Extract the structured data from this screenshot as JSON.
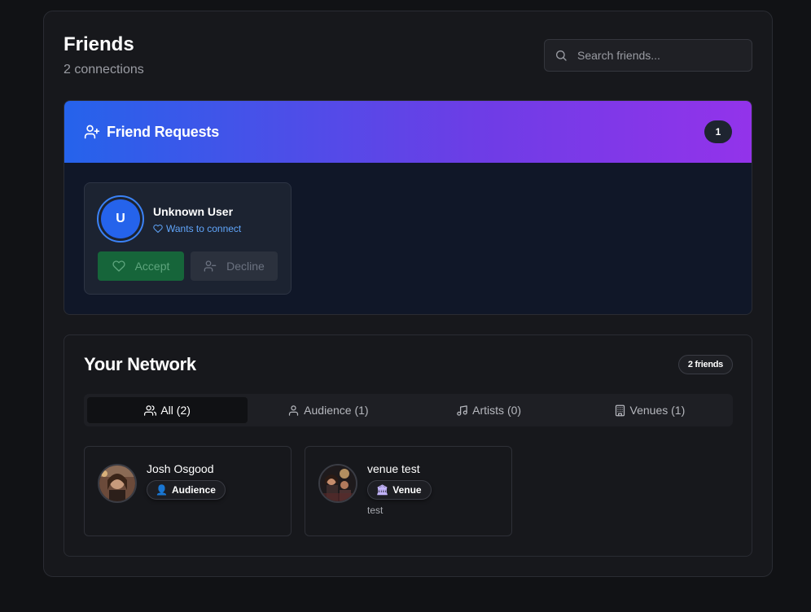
{
  "header": {
    "title": "Friends",
    "subtitle": "2 connections",
    "search_placeholder": "Search friends..."
  },
  "requests": {
    "title": "Friend Requests",
    "count": "1",
    "items": [
      {
        "initial": "U",
        "name": "Unknown User",
        "status": "Wants to connect",
        "accept_label": "Accept",
        "decline_label": "Decline"
      }
    ]
  },
  "network": {
    "title": "Your Network",
    "count_badge": "2 friends",
    "tabs": [
      {
        "label": "All (2)",
        "icon": "users-icon",
        "active": true
      },
      {
        "label": "Audience (1)",
        "icon": "user-icon",
        "active": false
      },
      {
        "label": "Artists (0)",
        "icon": "music-icon",
        "active": false
      },
      {
        "label": "Venues (1)",
        "icon": "building-icon",
        "active": false
      }
    ],
    "friends": [
      {
        "name": "Josh Osgood",
        "role": "Audience",
        "role_icon": "👤",
        "extra": ""
      },
      {
        "name": "venue test",
        "role": "Venue",
        "role_icon": "🏛",
        "extra": "test"
      }
    ]
  },
  "colors": {
    "accent_blue": "#2563eb",
    "accent_purple": "#9333ea",
    "accept_green": "#16653a",
    "link_blue": "#60a5fa"
  }
}
